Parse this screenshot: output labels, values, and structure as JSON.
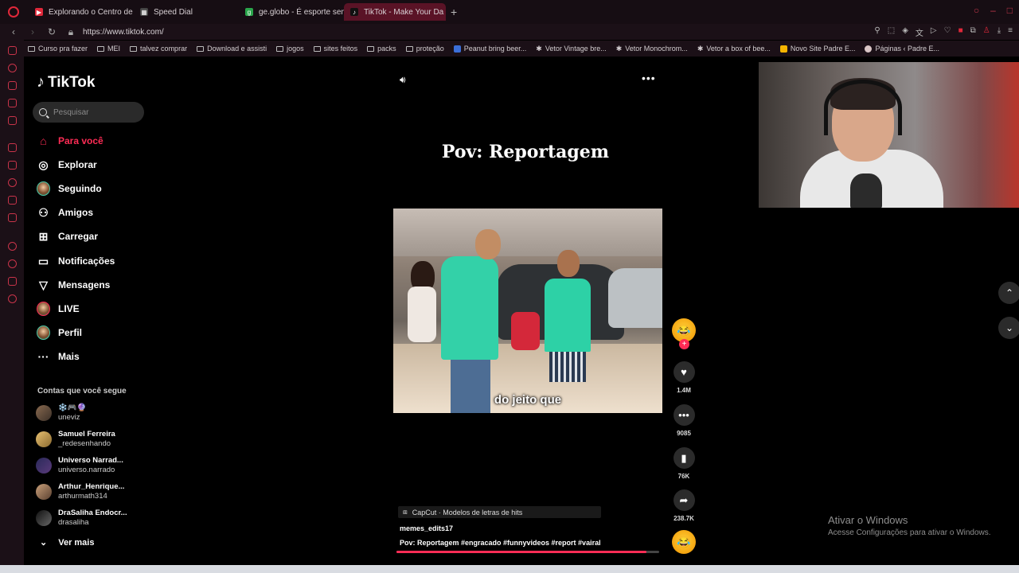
{
  "browser": {
    "tabs": [
      {
        "label": "Explorando o Centro de S",
        "color": "#e0283a"
      },
      {
        "label": "Speed Dial",
        "color": "#9aa0a6"
      },
      {
        "label": "ge.globo - É esporte sem",
        "color": "#2aa54b"
      },
      {
        "label": "TikTok - Make Your Da",
        "color": "#111111"
      }
    ],
    "url": "https://www.tiktok.com/",
    "bookmarks": [
      "Curso pra fazer",
      "MEI",
      "talvez comprar",
      "Download e assisti",
      "jogos",
      "sites feitos",
      "packs",
      "proteção",
      "Peanut bring beer...",
      "Vetor Vintage bre...",
      "Vetor Monochrom...",
      "Vetor a box of bee...",
      "Novo Site Padre E...",
      "Páginas ‹ Padre E..."
    ]
  },
  "tiktok": {
    "logo": "TikTok",
    "search_placeholder": "Pesquisar",
    "menu": [
      {
        "label": "Para você",
        "icon": "home-icon",
        "active": true
      },
      {
        "label": "Explorar",
        "icon": "compass-icon"
      },
      {
        "label": "Seguindo",
        "icon": "avatar-icon"
      },
      {
        "label": "Amigos",
        "icon": "friends-icon"
      },
      {
        "label": "Carregar",
        "icon": "upload-icon"
      },
      {
        "label": "Notificações",
        "icon": "bell-icon"
      },
      {
        "label": "Mensagens",
        "icon": "send-icon"
      },
      {
        "label": "LIVE",
        "icon": "live-icon"
      },
      {
        "label": "Perfil",
        "icon": "profile-icon"
      },
      {
        "label": "Mais",
        "icon": "more-icon"
      }
    ],
    "following_header": "Contas que você segue",
    "accounts": [
      {
        "name": "❄️🎮🔮",
        "handle": "uneviz"
      },
      {
        "name": "Samuel Ferreira",
        "handle": "_redesenhando"
      },
      {
        "name": "Universo Narrad...",
        "handle": "universo.narrado"
      },
      {
        "name": "Arthur_Henrique...",
        "handle": "arthurmath314"
      },
      {
        "name": "DraSaliha Endocr...",
        "handle": "drasaliha"
      }
    ],
    "see_more": "Ver mais"
  },
  "video": {
    "title": "Pov: Reportagem",
    "caption": "do jeito que",
    "likes": "1.4M",
    "comments": "9085",
    "saves": "76K",
    "shares": "238.7K",
    "capcut": "CapCut · Modelos de letras de hits",
    "username": "memes_edits17",
    "description": "Pov: Reportagem #engracado  #funnyvideos  #report  #vairal",
    "progress": 0.95
  },
  "windows_notice": {
    "line1": "Ativar o Windows",
    "line2": "Acesse Configurações para ativar o Windows."
  },
  "colors": {
    "accent": "#fe2c55",
    "browser_accent": "#e0283a"
  }
}
